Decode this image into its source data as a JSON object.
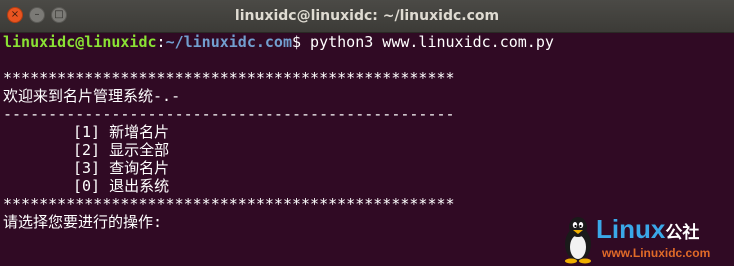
{
  "window": {
    "title": "linuxidc@linuxidc: ~/linuxidc.com",
    "buttons": {
      "close": "×",
      "minimize": "–",
      "maximize": "□"
    }
  },
  "terminal": {
    "prompt_user": "linuxidc@linuxidc",
    "prompt_colon": ":",
    "prompt_path": "~/linuxidc.com",
    "prompt_symbol": "$",
    "command": " python3 www.linuxidc.com.py",
    "stars": "**************************************************",
    "welcome": "欢迎来到名片管理系统-.-",
    "dashes": "--------------------------------------------------",
    "menu": [
      "[1] 新增名片",
      "[2] 显示全部",
      "[3] 查询名片",
      "[0] 退出系统"
    ],
    "input_prompt": "请选择您要进行的操作:"
  },
  "watermark": {
    "brand": "Linux",
    "brand_cn": "公社",
    "url": "www.Linuxidc.com"
  },
  "colors": {
    "background": "#300a24",
    "prompt_user": "#8ae234",
    "prompt_path": "#729fcf",
    "text": "#ffffff",
    "close_button": "#e95420"
  }
}
